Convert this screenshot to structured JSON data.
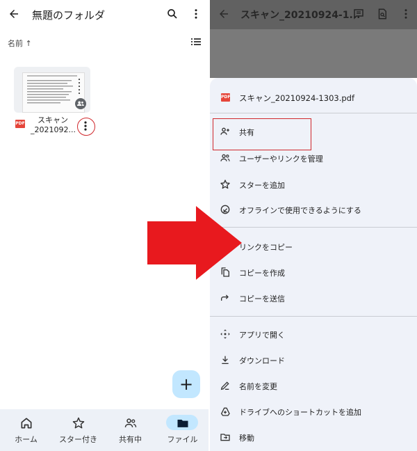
{
  "left_screen": {
    "header": {
      "title": "無題のフォルダ"
    },
    "sort": {
      "label": "名前 ↑"
    },
    "file": {
      "name_line1": "スキャン",
      "name_line2": "_2021092...",
      "type_badge": "PDF"
    },
    "fab": {
      "label": "+"
    },
    "bottom_nav": {
      "items": [
        {
          "label": "ホーム",
          "icon": "home-icon"
        },
        {
          "label": "スター付き",
          "icon": "star-icon"
        },
        {
          "label": "共有中",
          "icon": "people-icon"
        },
        {
          "label": "ファイル",
          "icon": "folder-icon",
          "selected": true
        }
      ]
    }
  },
  "right_screen": {
    "header": {
      "title": "スキャン_20210924-1..."
    },
    "sheet": {
      "file_name": "スキャン_20210924-1303.pdf",
      "type_badge": "PDF",
      "menu_items": [
        {
          "label": "共有",
          "icon": "person-add-icon"
        },
        {
          "label": "ユーザーやリンクを管理",
          "icon": "manage-people-icon"
        },
        {
          "label": "スターを追加",
          "icon": "star-icon"
        },
        {
          "label": "オフラインで使用できるようにする",
          "icon": "offline-icon"
        },
        {
          "label": "リンクをコピー",
          "icon": "copy-link-icon"
        },
        {
          "label": "コピーを作成",
          "icon": "make-copy-icon"
        },
        {
          "label": "コピーを送信",
          "icon": "send-copy-icon"
        },
        {
          "label": "アプリで開く",
          "icon": "open-with-icon"
        },
        {
          "label": "ダウンロード",
          "icon": "download-icon"
        },
        {
          "label": "名前を変更",
          "icon": "rename-icon"
        },
        {
          "label": "ドライブへのショートカットを追加",
          "icon": "add-shortcut-icon"
        },
        {
          "label": "移動",
          "icon": "move-icon"
        }
      ]
    }
  },
  "colors": {
    "accent": "#c2e7ff",
    "highlight_red": "#d0282c",
    "arrow_red": "#e8191e",
    "sheet_bg": "#eff2f9",
    "dim_header": "#616161",
    "pdf_red": "#e5453a"
  }
}
